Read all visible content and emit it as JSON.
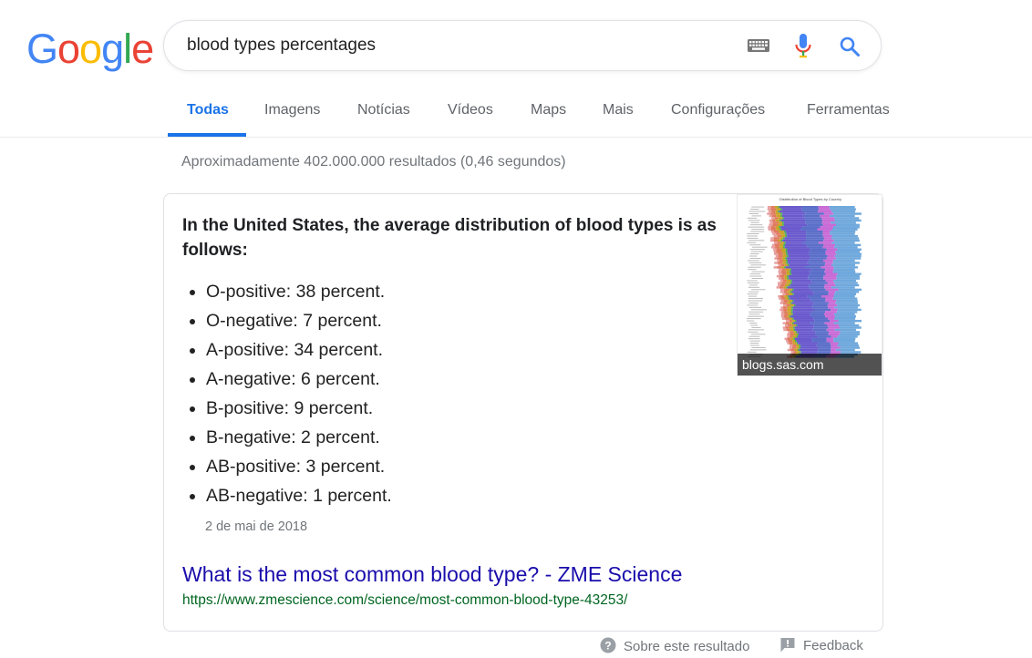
{
  "logo": {
    "letters": [
      "G",
      "o",
      "o",
      "g",
      "l",
      "e"
    ],
    "colors": [
      "#4285F4",
      "#EA4335",
      "#FBBC05",
      "#4285F4",
      "#34A853",
      "#EA4335"
    ]
  },
  "search": {
    "query": "blood types percentages",
    "keyboard_icon": "keyboard-icon",
    "mic_icon": "microphone-icon",
    "search_icon": "search-icon"
  },
  "tabs": [
    {
      "label": "Todas",
      "active": true
    },
    {
      "label": "Imagens"
    },
    {
      "label": "Notícias"
    },
    {
      "label": "Vídeos"
    },
    {
      "label": "Maps"
    },
    {
      "label": "Mais"
    },
    {
      "label": "Configurações"
    },
    {
      "label": "Ferramentas"
    }
  ],
  "results_stats": "Aproximadamente 402.000.000 resultados (0,46 segundos)",
  "snippet": {
    "headline": "In the United States, the average distribution of blood types is as follows:",
    "items": [
      "O-positive: 38 percent.",
      "O-negative: 7 percent.",
      "A-positive: 34 percent.",
      "A-negative: 6 percent.",
      "B-positive: 9 percent.",
      "B-negative: 2 percent.",
      "AB-positive: 3 percent.",
      "AB-negative: 1 percent."
    ],
    "date": "2 de mai de 2018",
    "link_title": "What is the most common blood type? - ZME Science",
    "link_url": "https://www.zmescience.com/science/most-common-blood-type-43253/",
    "image": {
      "caption": "blogs.sas.com",
      "chart_title": "Distribution of Blood Types by Country"
    }
  },
  "footer": {
    "about": "Sobre este resultado",
    "about_icon": "question-circle-icon",
    "feedback": "Feedback",
    "feedback_icon": "feedback-flag-icon"
  },
  "colors": {
    "accent": "#1a73e8",
    "link": "#1a0dab",
    "url": "#006621",
    "muted": "#70757a"
  }
}
